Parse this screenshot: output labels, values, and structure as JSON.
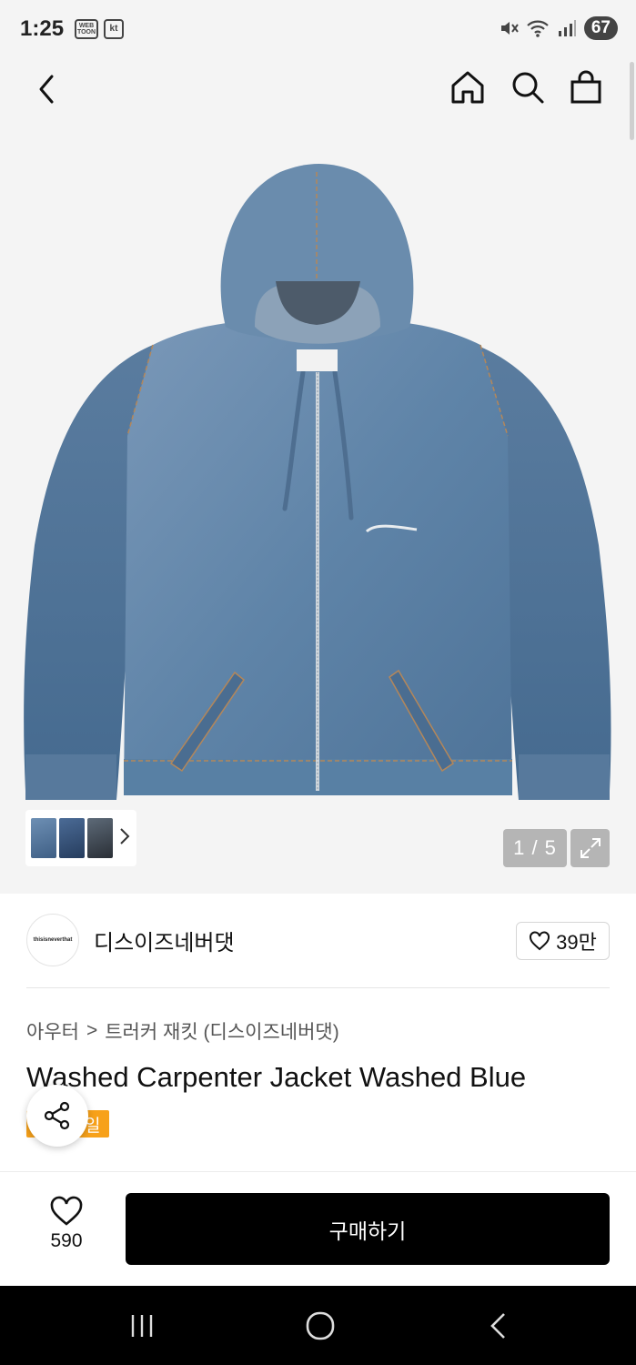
{
  "status_bar": {
    "time": "1:25",
    "app_badge_webtoon": "WEB TOON",
    "app_badge_kt": "kt",
    "battery": "67",
    "icons": [
      "mute-icon",
      "wifi-icon",
      "signal-icon"
    ]
  },
  "header": {
    "icons": [
      "back-icon",
      "home-icon",
      "search-icon",
      "shopping-bag-icon"
    ]
  },
  "gallery": {
    "counter": "1 / 5",
    "thumbnail_count": 3,
    "thumb_next_icon": "chevron-right-icon",
    "expand_icon": "expand-icon"
  },
  "brand": {
    "logo_text": "thisisneverthat",
    "name": "디스이즈네버댓",
    "like_count": "39만"
  },
  "product": {
    "category": [
      "아우터",
      "트러커 재킷 (디스이즈네버댓)"
    ],
    "category_separator": ">",
    "title": "Washed Carpenter Jacket Washed Blue",
    "badge": "세일",
    "badge_visible_part": "일"
  },
  "purchase_bar": {
    "wish_count": "590",
    "buy_label": "구매하기"
  },
  "colors": {
    "accent_sale": "#f7a11a",
    "buy_button": "#000000",
    "denim": "#5f84a8"
  }
}
